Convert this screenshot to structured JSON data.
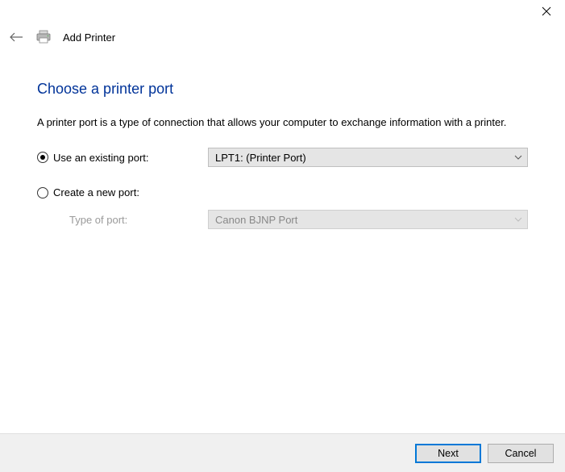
{
  "titlebar": {
    "close_icon": "✕"
  },
  "header": {
    "wizard_title": "Add Printer"
  },
  "content": {
    "heading": "Choose a printer port",
    "description": "A printer port is a type of connection that allows your computer to exchange information with a printer.",
    "option_existing_label": "Use an existing port:",
    "existing_port_selected": "LPT1: (Printer Port)",
    "option_create_label": "Create a new port:",
    "type_of_port_label": "Type of port:",
    "type_of_port_selected": "Canon BJNP Port"
  },
  "footer": {
    "next_label": "Next",
    "cancel_label": "Cancel"
  }
}
